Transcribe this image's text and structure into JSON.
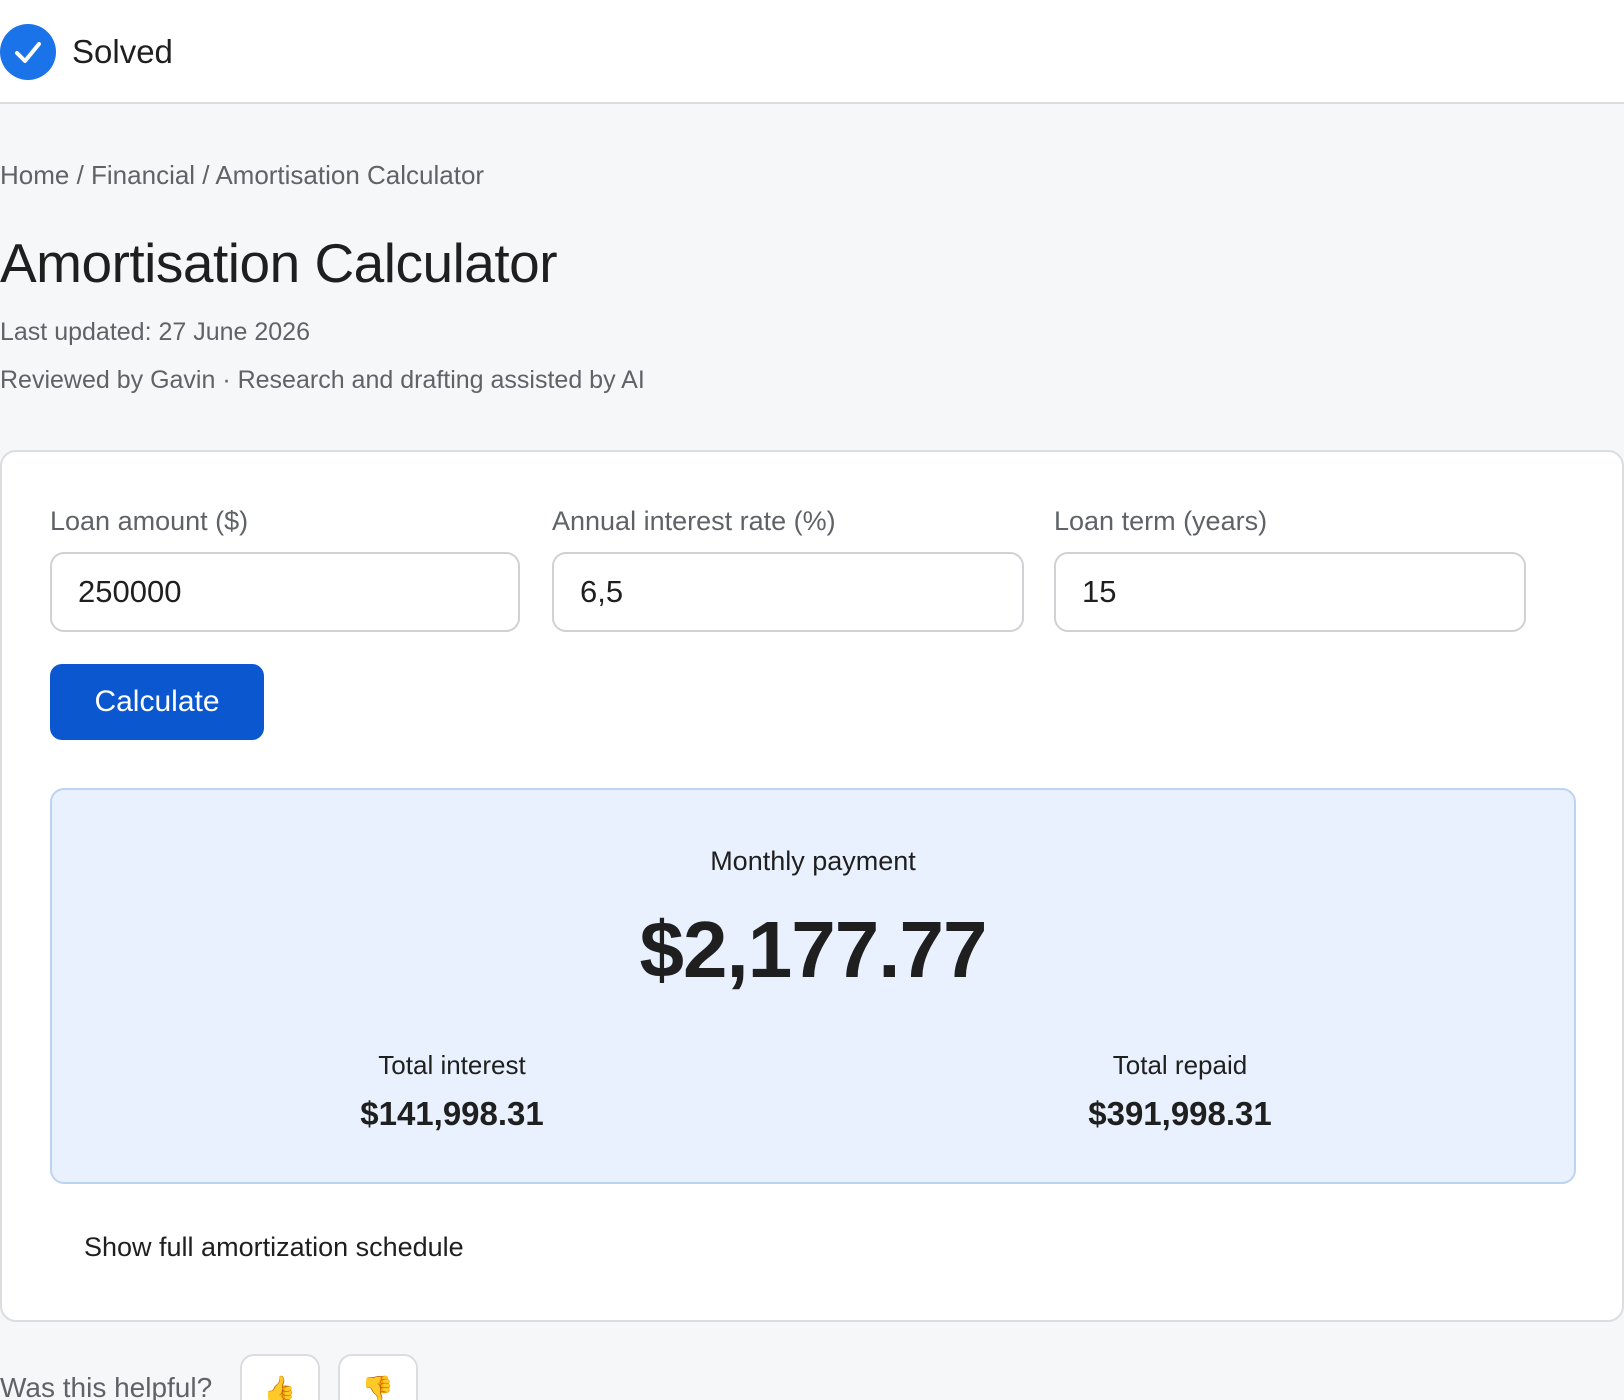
{
  "status": {
    "label": "Solved",
    "icon": "check-circle-icon",
    "color": "#1a73e8"
  },
  "breadcrumb": {
    "text": "Home / Financial / Amortisation Calculator"
  },
  "page": {
    "title": "Amortisation Calculator",
    "last_updated": "Last updated: 27 June 2026",
    "reviewed": "Reviewed by Gavin · Research and drafting assisted by AI"
  },
  "form": {
    "loan_amount_label": "Loan amount ($)",
    "loan_amount_value": "250000",
    "interest_rate_label": "Annual interest rate (%)",
    "interest_rate_value": "6,5",
    "loan_term_label": "Loan term (years)",
    "loan_term_value": "15",
    "calculate_label": "Calculate"
  },
  "results": {
    "monthly_label": "Monthly payment",
    "monthly_value": "$2,177.77",
    "total_interest_label": "Total interest",
    "total_interest_value": "$141,998.31",
    "total_repaid_label": "Total repaid",
    "total_repaid_value": "$391,998.31"
  },
  "schedule": {
    "toggle_label": "Show full amortization schedule"
  },
  "feedback": {
    "question": "Was this helpful?",
    "thumbs_up": "👍",
    "thumbs_down": "👎"
  },
  "colors": {
    "accent": "#0b57d0",
    "result_background": "#e8f1fd"
  }
}
